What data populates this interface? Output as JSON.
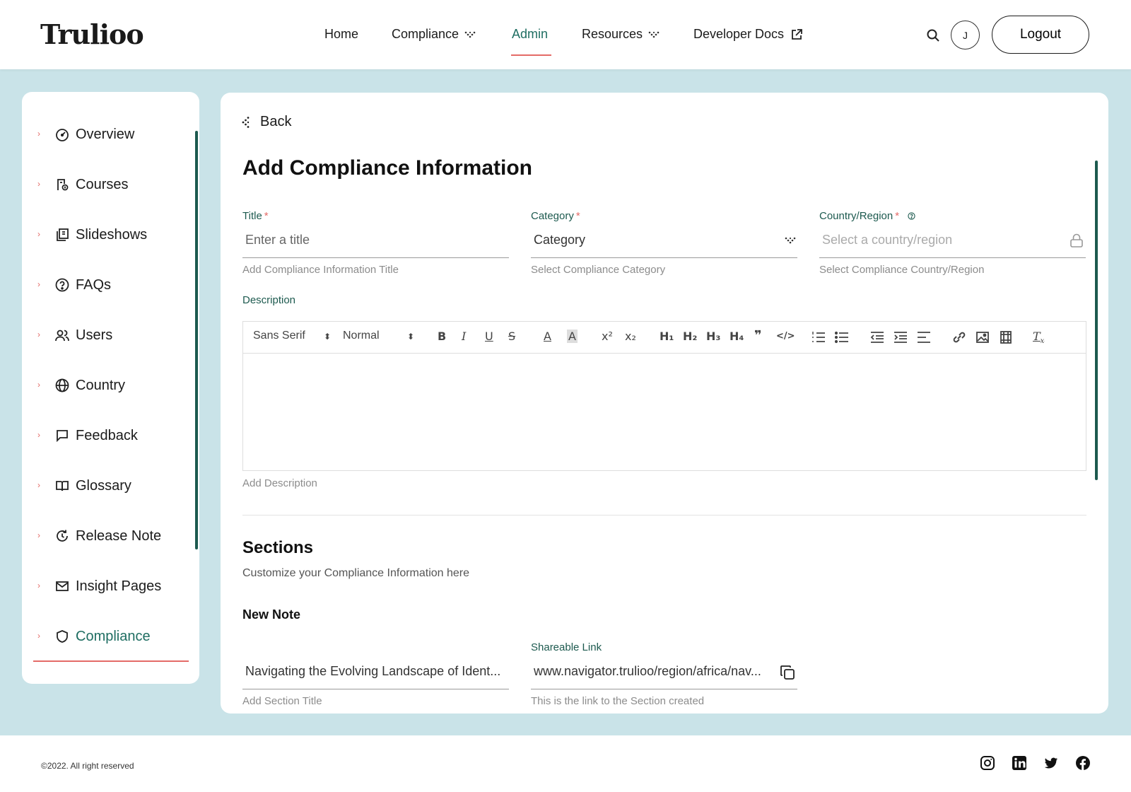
{
  "brand": {
    "logo": "Trulioo"
  },
  "nav": {
    "items": [
      {
        "label": "Home"
      },
      {
        "label": "Compliance"
      },
      {
        "label": "Admin"
      },
      {
        "label": "Resources"
      },
      {
        "label": "Developer Docs"
      }
    ],
    "active": "Admin",
    "avatar_initial": "J",
    "logout_label": "Logout"
  },
  "sidebar": {
    "items": [
      {
        "label": "Overview",
        "icon": "gauge-icon"
      },
      {
        "label": "Courses",
        "icon": "course-icon"
      },
      {
        "label": "Slideshows",
        "icon": "slideshow-icon"
      },
      {
        "label": "FAQs",
        "icon": "question-icon"
      },
      {
        "label": "Users",
        "icon": "users-icon"
      },
      {
        "label": "Country",
        "icon": "globe-icon"
      },
      {
        "label": "Feedback",
        "icon": "chat-icon"
      },
      {
        "label": "Glossary",
        "icon": "book-icon"
      },
      {
        "label": "Release Note",
        "icon": "refresh-icon"
      },
      {
        "label": "Insight Pages",
        "icon": "mail-icon"
      },
      {
        "label": "Compliance",
        "icon": "shield-icon"
      }
    ],
    "active": "Compliance"
  },
  "main": {
    "back_label": "Back",
    "title": "Add Compliance Information",
    "fields": {
      "title": {
        "label": "Title",
        "required": "*",
        "placeholder": "Enter a title",
        "help": "Add Compliance Information Title"
      },
      "category": {
        "label": "Category",
        "required": "*",
        "value": "Category",
        "help": "Select Compliance Category"
      },
      "country": {
        "label": "Country/Region",
        "required": "*",
        "placeholder": "Select a country/region",
        "help": "Select Compliance Country/Region"
      }
    },
    "description": {
      "label": "Description",
      "font_select": "Sans Serif",
      "size_select": "Normal",
      "help": "Add Description"
    },
    "sections": {
      "title": "Sections",
      "subtitle": "Customize your Compliance Information here",
      "note_title": "New Note",
      "section_title_value": "Navigating the Evolving Landscape of Ident...",
      "section_title_help": "Add Section Title",
      "link_label": "Shareable Link",
      "link_value": "www.navigator.trulioo/region/africa/nav...",
      "link_help": "This is the link to the Section created"
    }
  },
  "footer": {
    "copyright": "©2022. All right reserved"
  },
  "colors": {
    "accent": "#1f6e62",
    "underline": "#e46b67",
    "background": "#c9e3e8"
  }
}
